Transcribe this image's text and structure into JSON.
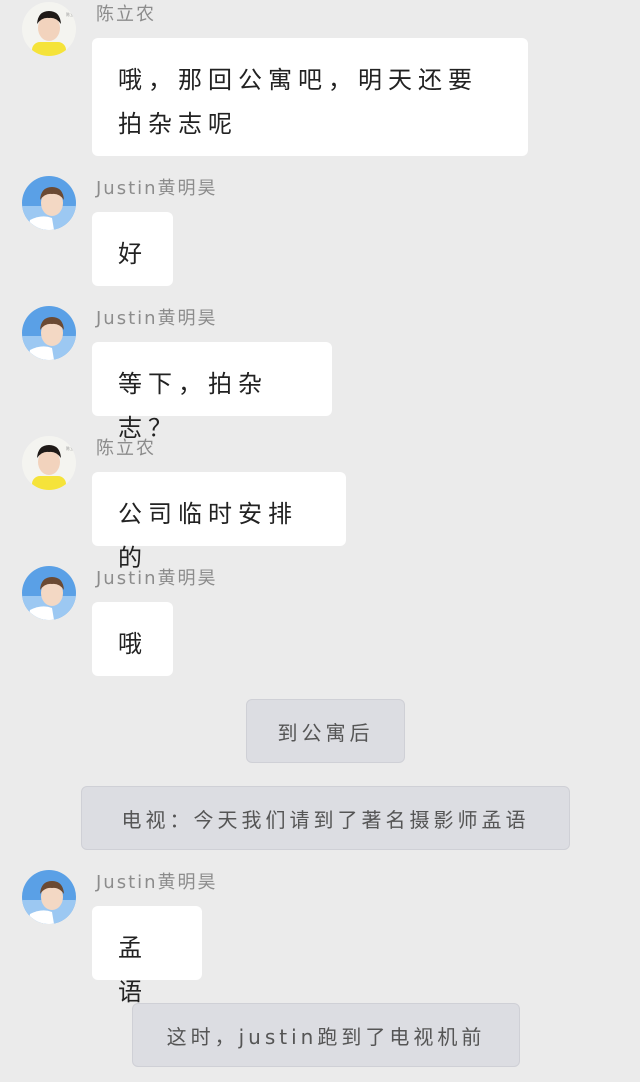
{
  "messages": [
    {
      "sender": "陈立农",
      "text": "哦，那回公寓吧，明天还要拍杂志呢",
      "avatar": "boy-yellow-shirt-avatar"
    },
    {
      "sender": "Justin黄明昊",
      "text": "好",
      "avatar": "boy-blue-background-avatar"
    },
    {
      "sender": "Justin黄明昊",
      "text": "等下，拍杂志？",
      "avatar": "boy-blue-background-avatar"
    },
    {
      "sender": "陈立农",
      "text": "公司临时安排的",
      "avatar": "boy-yellow-shirt-avatar"
    },
    {
      "sender": "Justin黄明昊",
      "text": "哦",
      "avatar": "boy-blue-background-avatar"
    },
    {
      "sender": "Justin黄明昊",
      "text": "孟语",
      "avatar": "boy-blue-background-avatar"
    }
  ],
  "narrations": [
    {
      "text": "到公寓后"
    },
    {
      "text": "电视：今天我们请到了著名摄影师孟语"
    },
    {
      "text": "这时，justin跑到了电视机前"
    }
  ],
  "colors": {
    "background": "#ebebeb",
    "bubble": "#ffffff",
    "narration_bg": "#dcdde2",
    "sender_text": "#8c8c8c"
  }
}
